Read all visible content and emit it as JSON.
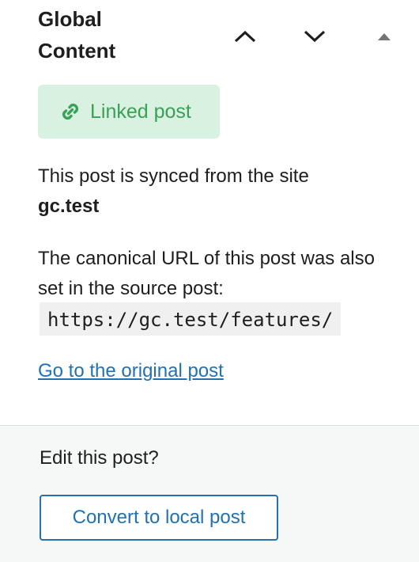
{
  "header": {
    "title": "Global Content",
    "move_up_icon": "chevron-up-icon",
    "move_down_icon": "chevron-down-icon",
    "toggle_icon": "triangle-up-icon"
  },
  "badge": {
    "icon": "link-icon",
    "label": "Linked post",
    "colors": {
      "background": "#d9f1e0",
      "text": "#3a9f57"
    }
  },
  "sync_info": {
    "text": "This post is synced from the site",
    "site": "gc.test"
  },
  "canonical": {
    "text": "The canonical URL of this post was also set in the source post:",
    "url": "https://gc.test/features/"
  },
  "original_link": {
    "label": "Go to the original post"
  },
  "footer": {
    "prompt": "Edit this post?",
    "convert_button": "Convert to local post"
  },
  "colors": {
    "accent": "#2271b1",
    "footer_background": "#f6f7f7"
  }
}
